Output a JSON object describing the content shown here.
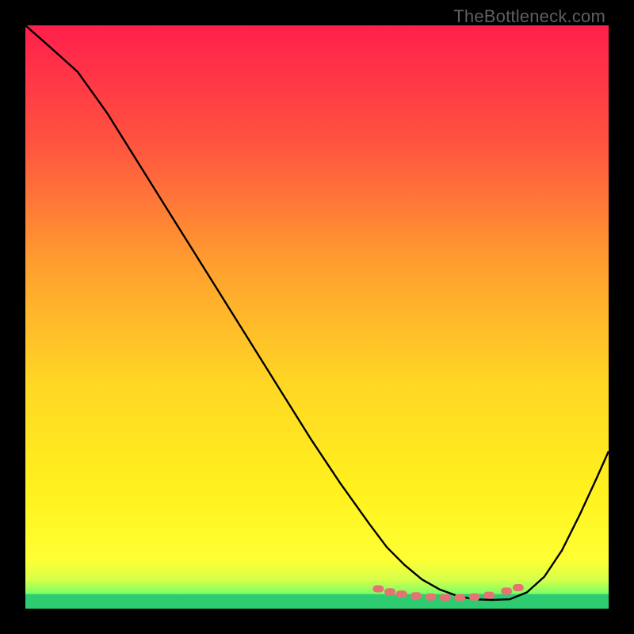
{
  "watermark": "TheBottleneck.com",
  "colors": {
    "curve": "#000000",
    "dots": "#e57373",
    "band": "#2ecc71",
    "frame": "#000000"
  },
  "chart_data": {
    "type": "line",
    "title": "",
    "xlabel": "",
    "ylabel": "",
    "xlim": [
      0,
      100
    ],
    "ylim": [
      0,
      100
    ],
    "gradient_stops": [
      {
        "offset": 0,
        "color": "#ff1f4b"
      },
      {
        "offset": 0.2,
        "color": "#ff5340"
      },
      {
        "offset": 0.42,
        "color": "#ffa22e"
      },
      {
        "offset": 0.62,
        "color": "#ffd824"
      },
      {
        "offset": 0.8,
        "color": "#fff21e"
      },
      {
        "offset": 0.915,
        "color": "#ffff33"
      },
      {
        "offset": 0.95,
        "color": "#d8ff4a"
      },
      {
        "offset": 0.975,
        "color": "#7aff66"
      },
      {
        "offset": 1.0,
        "color": "#2ecc71"
      }
    ],
    "series": [
      {
        "name": "bottleneck-curve",
        "x": [
          0,
          4,
          9,
          14,
          19,
          24,
          29,
          34,
          39,
          44,
          49,
          54,
          59,
          62,
          65,
          68,
          71,
          74,
          77,
          80,
          83,
          86,
          89,
          92,
          95,
          98,
          100
        ],
        "y": [
          100,
          96.5,
          92,
          85,
          77,
          69,
          61,
          53,
          45,
          37,
          29,
          21.5,
          14.5,
          10.5,
          7.5,
          5,
          3.3,
          2.2,
          1.6,
          1.5,
          1.6,
          2.8,
          5.5,
          10,
          16,
          22.5,
          27
        ]
      }
    ],
    "markers": {
      "name": "optimal-range-dots",
      "x": [
        60.5,
        62.5,
        64.5,
        67,
        69.5,
        72,
        74.5,
        77,
        79.5,
        82.5,
        84.5
      ],
      "y": [
        3.4,
        2.9,
        2.5,
        2.2,
        2.0,
        1.9,
        1.9,
        2.0,
        2.3,
        3.0,
        3.6
      ]
    }
  }
}
